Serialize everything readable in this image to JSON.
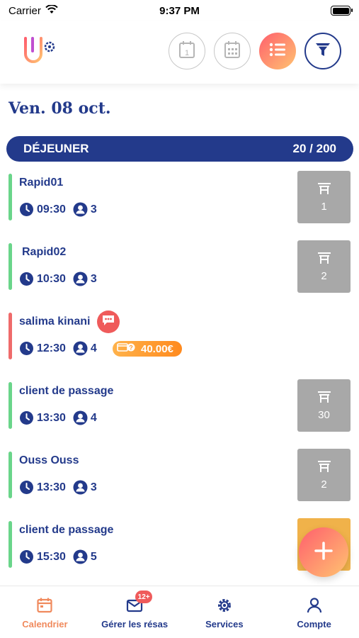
{
  "status_bar": {
    "carrier": "Carrier",
    "time": "9:37 PM"
  },
  "header": {
    "buttons": [
      {
        "icon": "calendar-day-icon"
      },
      {
        "icon": "calendar-month-icon"
      },
      {
        "icon": "list-icon",
        "active": true
      },
      {
        "icon": "filter-icon"
      }
    ]
  },
  "date_title": "Ven. 08 oct.",
  "service": {
    "name": "DÉJEUNER",
    "count": "20 / 200"
  },
  "reservations": [
    {
      "name": "Rapid01",
      "time": "09:30",
      "guests": "3",
      "table": "1",
      "status": "green"
    },
    {
      "name": "Rapid02",
      "time": "10:30",
      "guests": "3",
      "table": "2",
      "status": "green"
    },
    {
      "name": "salima kinani",
      "time": "12:30",
      "guests": "4",
      "table": "",
      "status": "red",
      "price": "40.00€",
      "has_message": true
    },
    {
      "name": "client de passage",
      "time": "13:30",
      "guests": "4",
      "table": "30",
      "status": "green"
    },
    {
      "name": "Ouss Ouss",
      "time": "13:30",
      "guests": "3",
      "table": "2",
      "status": "green"
    },
    {
      "name": "client de passage",
      "time": "15:30",
      "guests": "5",
      "table": "",
      "status": "green"
    }
  ],
  "colors": {
    "primary": "#233a8b",
    "accent": "#f08a5d",
    "green": "#6ad58a",
    "red": "#ef6b6b",
    "tile": "#a8a8a8"
  },
  "tabs": [
    {
      "label": "Calendrier",
      "icon": "calendar-icon",
      "active": true
    },
    {
      "label": "Gérer les résas",
      "icon": "mail-icon",
      "badge": "12+"
    },
    {
      "label": "Services",
      "icon": "gear-icon"
    },
    {
      "label": "Compte",
      "icon": "user-icon"
    }
  ]
}
